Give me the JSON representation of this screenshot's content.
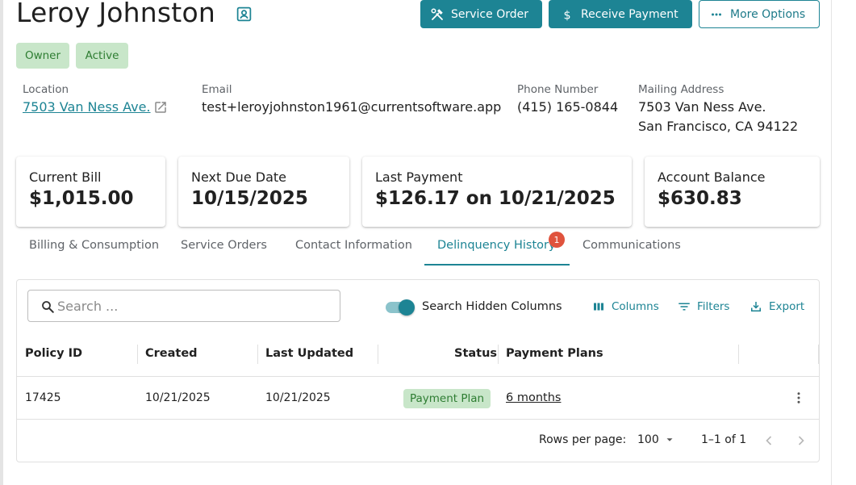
{
  "customer": {
    "name": "Leroy Johnston",
    "tags": [
      "Owner",
      "Active"
    ]
  },
  "header_actions": {
    "service_order": "Service Order",
    "receive_payment": "Receive Payment",
    "more_options": "More Options"
  },
  "info": {
    "location_label": "Location",
    "location_value": "7503 Van Ness Ave.",
    "email_label": "Email",
    "email_value": "test+leroyjohnston1961@currentsoftware.app",
    "phone_label": "Phone Number",
    "phone_value": "(415) 165-0844",
    "mailing_label": "Mailing Address",
    "mailing_line1": "7503 Van Ness Ave.",
    "mailing_line2": "San Francisco, CA 94122"
  },
  "summary_cards": [
    {
      "label": "Current Bill",
      "value": "$1,015.00"
    },
    {
      "label": "Next Due Date",
      "value": "10/15/2025"
    },
    {
      "label": "Last Payment",
      "value": "$126.17 on 10/21/2025"
    },
    {
      "label": "Account Balance",
      "value": "$630.83"
    }
  ],
  "tabs": [
    {
      "label": "Billing & Consumption"
    },
    {
      "label": "Service Orders"
    },
    {
      "label": "Contact Information"
    },
    {
      "label": "Delinquency History",
      "badge": "1",
      "active": true
    },
    {
      "label": "Communications"
    }
  ],
  "grid": {
    "search_placeholder": "Search ...",
    "search_value": "",
    "toggle_label": "Search Hidden Columns",
    "toggle_on": true,
    "toolbar": {
      "columns": "Columns",
      "filters": "Filters",
      "export": "Export"
    },
    "columns": [
      "Policy ID",
      "Created",
      "Last Updated",
      "Status",
      "Payment Plans"
    ],
    "rows": [
      {
        "policy_id": "17425",
        "created": "10/21/2025",
        "last_updated": "10/21/2025",
        "status": "Payment Plan",
        "payment_plans": "6 months"
      }
    ],
    "footer": {
      "rows_per_page_label": "Rows per page:",
      "rows_per_page_value": "100",
      "range": "1–1 of 1"
    }
  },
  "colors": {
    "accent": "#1d8494",
    "chip_bg": "#c8e6c9",
    "chip_text": "#2e7d32",
    "badge": "#e0533d"
  },
  "icons": [
    "contact-card-icon",
    "tools-icon",
    "dollar-icon",
    "more-horiz-icon",
    "open-external-icon",
    "search-icon",
    "columns-icon",
    "filter-icon",
    "export-icon",
    "more-vert-icon",
    "chevron-down-icon",
    "chevron-left-icon",
    "chevron-right-icon"
  ]
}
